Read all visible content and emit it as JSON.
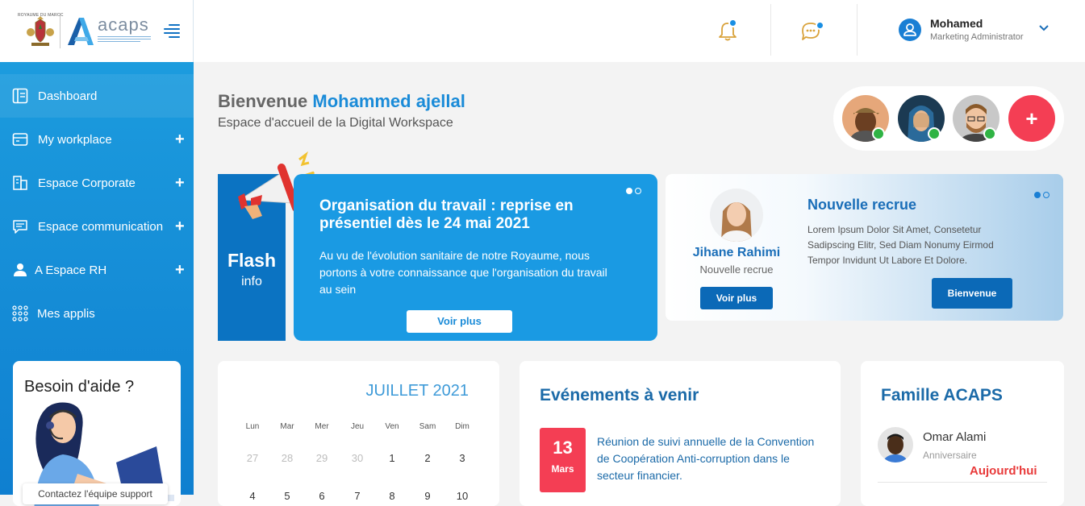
{
  "brand": {
    "crest_caption": "ROYAUME DU MAROC",
    "name": "acaps"
  },
  "sidebar": {
    "items": [
      {
        "label": "Dashboard",
        "icon": "dashboard-icon",
        "expandable": false
      },
      {
        "label": "My workplace",
        "icon": "workplace-icon",
        "expandable": true
      },
      {
        "label": "Espace Corporate",
        "icon": "corporate-icon",
        "expandable": true
      },
      {
        "label": "Espace communication",
        "icon": "chat-icon",
        "expandable": true
      },
      {
        "label": "A Espace RH",
        "icon": "user-icon",
        "expandable": true
      },
      {
        "label": "Mes applis",
        "icon": "apps-grid-icon",
        "expandable": false
      }
    ],
    "expand_symbol": "+",
    "help": {
      "title": "Besoin d'aide ?",
      "contact": "Contactez l'équipe support"
    }
  },
  "header": {
    "user": {
      "name": "Mohamed",
      "role": "Marketing Administrator"
    }
  },
  "welcome": {
    "greeting": "Bienvenue ",
    "name": "Mohammed ajellal",
    "subtitle": "Espace d'accueil de la Digital Workspace"
  },
  "contacts": {
    "add_label": "+"
  },
  "flash": {
    "tag_big": "Flash",
    "tag_small": "info",
    "title": "Organisation du travail : reprise en présentiel dès le 24 mai 2021",
    "text": "Au vu de l'évolution sanitaire de notre Royaume, nous portons à votre connaissance que l'organisation du travail au sein",
    "button": "Voir plus"
  },
  "recrue": {
    "name": "Jihane Rahimi",
    "role": "Nouvelle recrue",
    "button": "Voir plus",
    "title": "Nouvelle recrue",
    "text": "Lorem Ipsum Dolor Sit Amet, Consetetur Sadipscing Elitr, Sed Diam Nonumy Eirmod Tempor Invidunt Ut Labore Et Dolore.",
    "button2": "Bienvenue"
  },
  "calendar": {
    "month": "JUILLET 2021",
    "weekdays": [
      "Lun",
      "Mar",
      "Mer",
      "Jeu",
      "Ven",
      "Sam",
      "Dim"
    ],
    "row1": [
      "27",
      "28",
      "29",
      "30",
      "1",
      "2",
      "3"
    ],
    "row2": [
      "4",
      "5",
      "6",
      "7",
      "8",
      "9",
      "10"
    ]
  },
  "events": {
    "title": "Evénements à venir",
    "items": [
      {
        "day": "13",
        "month": "Mars",
        "text": "Réunion de suivi annuelle de la Convention de Coopération Anti-corruption dans le secteur financier."
      }
    ]
  },
  "famille": {
    "title": "Famille ACAPS",
    "items": [
      {
        "name": "Omar Alami",
        "sub": "Anniversaire",
        "when": "Aujourd'hui"
      }
    ]
  },
  "colors": {
    "sidebar_top": "#1ea0e0",
    "sidebar_bottom": "#0f7fd0",
    "accent": "#1a8bd8",
    "dark_blue": "#0b69b7",
    "alert_red": "#f43e54",
    "online_green": "#2fb344"
  }
}
